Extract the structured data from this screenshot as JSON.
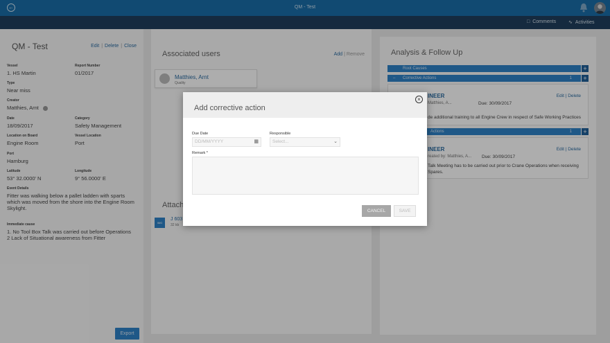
{
  "topbar": {
    "title": "QM - Test",
    "back_icon": "arrow-left-circle-icon"
  },
  "subbar": {
    "comments_label": "Comments",
    "activities_label": "Activities"
  },
  "report": {
    "title": "QM - Test",
    "actions": [
      "Edit",
      "Delete",
      "Close"
    ],
    "fields": [
      {
        "label": "Vessel",
        "value": "1. HS Martin"
      },
      {
        "label": "Report Number",
        "value": "01/2017"
      },
      {
        "label": "Type",
        "value": "Near miss"
      },
      {
        "label": "Creator",
        "value": "Matthies, Arnt"
      },
      {
        "label": "Date",
        "value": "18/09/2017"
      },
      {
        "label": "Category",
        "value": "Safety Management"
      },
      {
        "label": "Location on Board",
        "value": "Engine Room"
      },
      {
        "label": "Vessel Location",
        "value": "Port"
      },
      {
        "label": "Port",
        "value": "Hamburg"
      },
      {
        "label": "Latitude",
        "value": "53° 32.0000' N"
      },
      {
        "label": "Longitude",
        "value": "9° 56.0000' E"
      },
      {
        "label": "Event Details",
        "value": "Fitter was walking below a pallet ladden with sparts which was moved from the shore into the Engine Room Skylight."
      },
      {
        "label": "Immediate cause",
        "value": "1. No Tool Box Talk was carried out before Operations 2 Lack of Situational awareness from Fitter"
      }
    ],
    "export_label": "Export"
  },
  "associated_users": {
    "title": "Associated users",
    "add_label": "Add",
    "remove_label": "Remove",
    "user_name": "Matthies, Arnt",
    "user_role": "Quality"
  },
  "attachments": {
    "title": "Attach",
    "file_icon_label": "IMG",
    "file_name": "J 603",
    "file_size": "32 kb"
  },
  "analysis": {
    "title": "Analysis & Follow Up",
    "root_causes_label": "Root Causes",
    "corrective_label": "Corrective Actions",
    "corrective_count": "1",
    "preventive_label": "Actions",
    "preventive_count": "1",
    "card1": {
      "heading": "INEER",
      "meta": "Matthies, A...",
      "due": "Due: 30/09/2017",
      "text": "de additional training to all Engine Crew in respect of Safe Working Practices"
    },
    "card2": {
      "heading": "INEER",
      "meta": "reated by: Matthies, A...",
      "due": "Due: 30/09/2017",
      "text1": "Talk Meeting has to be carried out prior to Crane Operations when receiving",
      "text2": "Spares."
    },
    "edit_label": "Edit",
    "delete_label": "Delete"
  },
  "modal": {
    "title": "Add corrective action",
    "due_date_label": "Due Date",
    "due_date_placeholder": "DD/MM/YYYY",
    "responsible_label": "Responsible",
    "responsible_placeholder": "Select...",
    "remark_label": "Remark *",
    "cancel_label": "CANCEL",
    "save_label": "SAVE"
  },
  "colors": {
    "primary": "#1a6ea8",
    "nav": "#1f3f5e",
    "accent": "#2f82c8"
  }
}
